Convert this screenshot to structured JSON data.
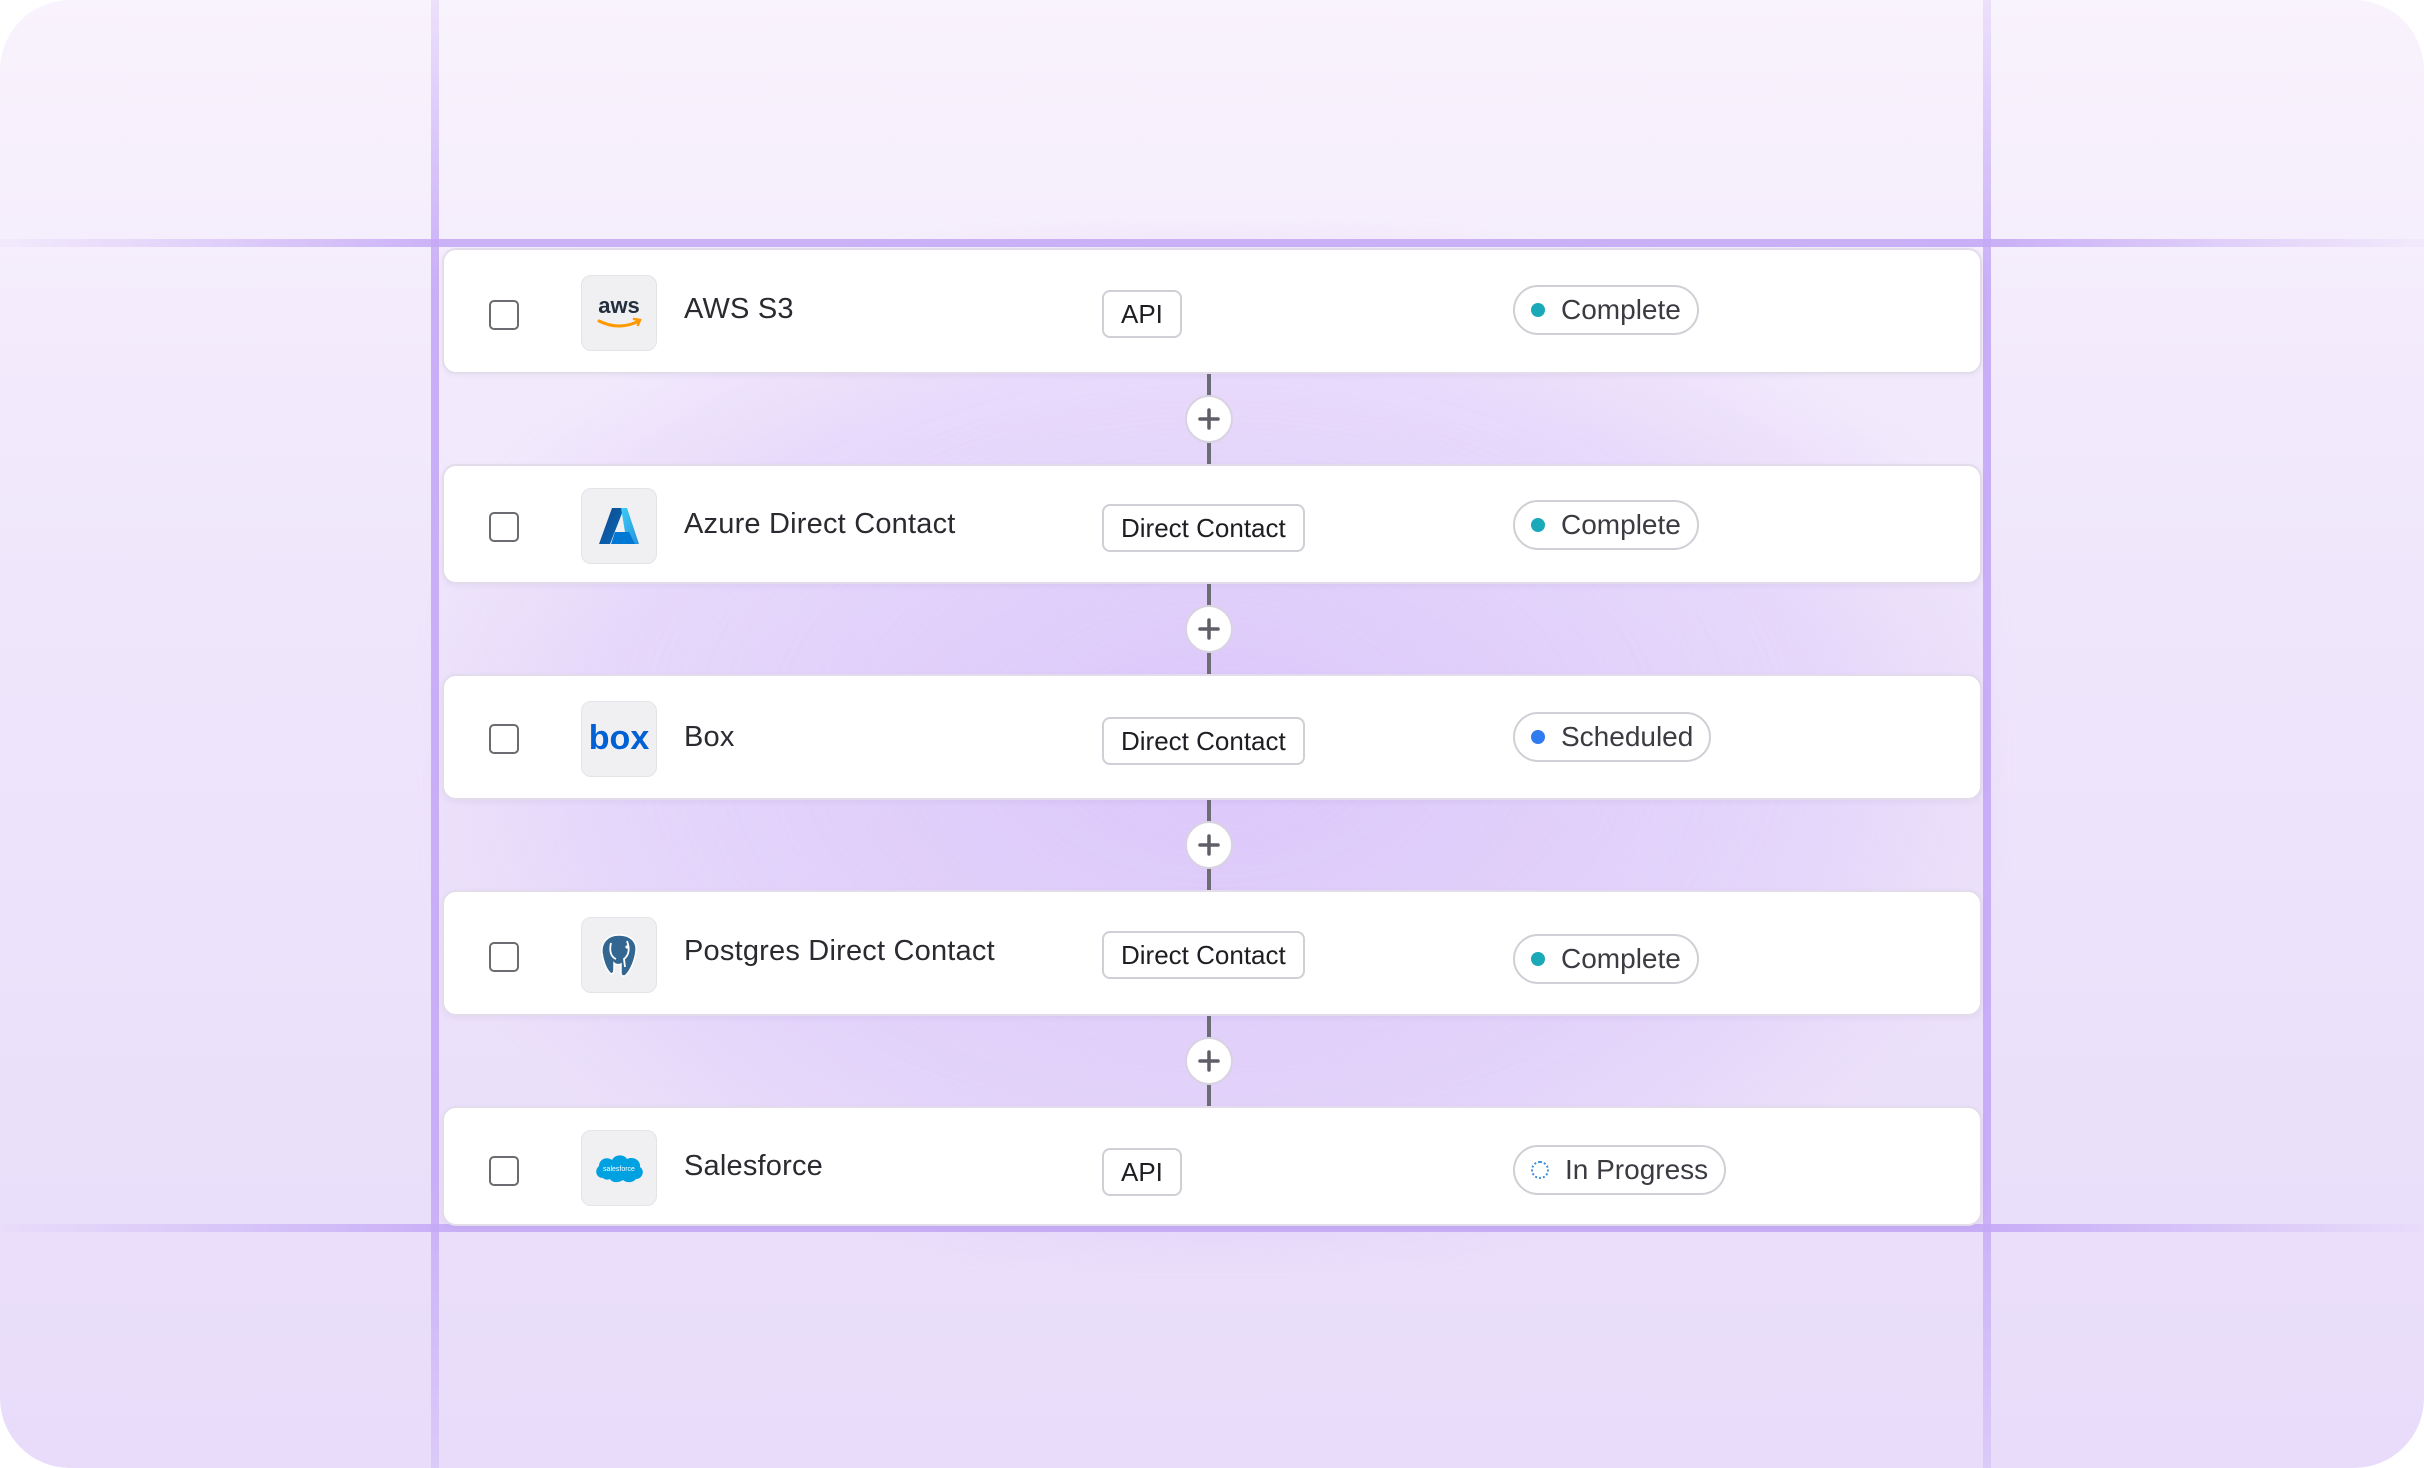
{
  "connections": [
    {
      "name": "AWS S3",
      "logo": "aws-logo",
      "type": "API",
      "status": "Complete",
      "status_color": "#1aa9b8"
    },
    {
      "name": "Azure Direct Contact",
      "logo": "azure-logo",
      "type": "Direct Contact",
      "status": "Complete",
      "status_color": "#1aa9b8"
    },
    {
      "name": "Box",
      "logo": "box-logo",
      "type": "Direct Contact",
      "status": "Scheduled",
      "status_color": "#2f7bf0"
    },
    {
      "name": "Postgres Direct Contact",
      "logo": "postgres-logo",
      "type": "Direct Contact",
      "status": "Complete",
      "status_color": "#1aa9b8"
    },
    {
      "name": "Salesforce",
      "logo": "salesforce-logo",
      "type": "API",
      "status": "In Progress",
      "status_color": "#3b8fe0"
    }
  ],
  "logos": {
    "aws_text": "aws",
    "box_text": "box",
    "salesforce_text": "salesforce"
  },
  "add_icon": "plus-icon",
  "colors": {
    "accent_line": "#c4a8f6",
    "connector": "#6c6c74",
    "complete": "#1aa9b8",
    "scheduled": "#2f7bf0",
    "in_progress": "#3b8fe0"
  }
}
